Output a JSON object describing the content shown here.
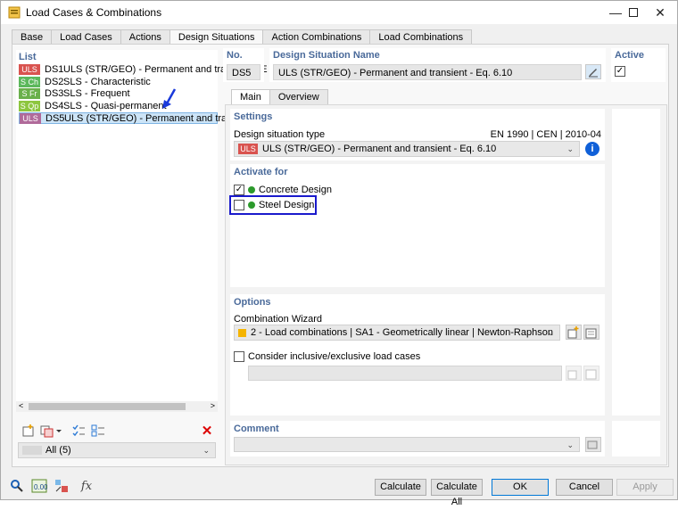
{
  "window": {
    "title": "Load Cases & Combinations"
  },
  "tabs": [
    "Base",
    "Load Cases",
    "Actions",
    "Design Situations",
    "Action Combinations",
    "Load Combinations"
  ],
  "list": {
    "label": "List",
    "items": [
      {
        "badge": "ULS",
        "badge_color": "#d9534f",
        "id": "DS1",
        "name": "ULS (STR/GEO) - Permanent and transient - E"
      },
      {
        "badge": "S Ch",
        "badge_color": "#5cb85c",
        "id": "DS2",
        "name": "SLS - Characteristic"
      },
      {
        "badge": "S Fr",
        "badge_color": "#6ab04c",
        "id": "DS3",
        "name": "SLS - Frequent"
      },
      {
        "badge": "S Qp",
        "badge_color": "#8dc63f",
        "id": "DS4",
        "name": "SLS - Quasi-permanent"
      },
      {
        "badge": "ULS",
        "badge_color": "#b06a9a",
        "id": "DS5",
        "name": "ULS (STR/GEO) - Permanent and transient - E"
      }
    ],
    "filter_value": "All (5)"
  },
  "header": {
    "no_label": "No.",
    "no_value": "DS5",
    "name_label": "Design Situation Name",
    "name_value": "ULS (STR/GEO) - Permanent and transient - Eq. 6.10",
    "active_label": "Active"
  },
  "subtabs": [
    "Main",
    "Overview"
  ],
  "settings": {
    "label": "Settings",
    "type_label": "Design situation type",
    "standard": "EN 1990 | CEN | 2010-04",
    "type_badge": "ULS",
    "type_value": "ULS (STR/GEO) - Permanent and transient - Eq. 6.10"
  },
  "activate": {
    "label": "Activate for",
    "items": [
      {
        "label": "Concrete Design",
        "checked": true
      },
      {
        "label": "Steel Design",
        "checked": false
      }
    ]
  },
  "options": {
    "label": "Options",
    "wizard_label": "Combination Wizard",
    "wizard_value": "2 - Load combinations | SA1 - Geometrically linear | Newton-Raphson",
    "inclusive_label": "Consider inclusive/exclusive load cases"
  },
  "comment": {
    "label": "Comment"
  },
  "buttons": {
    "calculate": "Calculate",
    "calculate_all": "Calculate All",
    "ok": "OK",
    "cancel": "Cancel",
    "apply": "Apply"
  },
  "colors": {
    "accent": "#0078d7",
    "highlight_box": "#1a1acc",
    "selection": "#cce4f7",
    "arrow": "#1a3adb"
  }
}
